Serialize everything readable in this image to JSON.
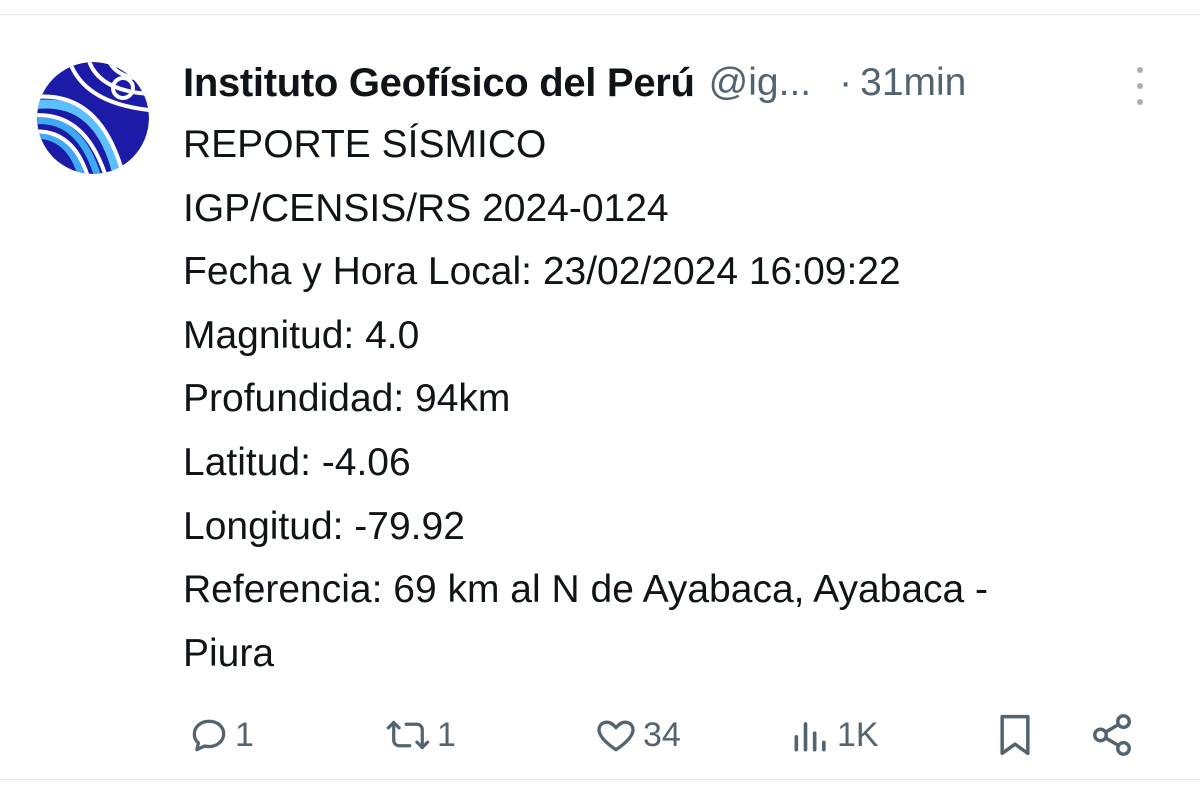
{
  "tweet": {
    "author_name": "Instituto Geofísico del Perú",
    "handle": "@ig...",
    "separator": "·",
    "time": "31min",
    "lines": [
      "REPORTE SÍSMICO",
      "IGP/CENSIS/RS 2024-0124",
      "Fecha y Hora Local: 23/02/2024 16:09:22",
      "Magnitud: 4.0",
      "Profundidad: 94km",
      "Latitud: -4.06",
      "Longitud: -79.92",
      "Referencia: 69 km al N de Ayabaca, Ayabaca -",
      "Piura"
    ]
  },
  "actions": {
    "reply": {
      "icon": "reply-icon",
      "count": "1"
    },
    "retweet": {
      "icon": "retweet-icon",
      "count": "1"
    },
    "like": {
      "icon": "heart-icon",
      "count": "34"
    },
    "views": {
      "icon": "views-icon",
      "count": "1K"
    },
    "bookmark": {
      "icon": "bookmark-icon"
    },
    "share": {
      "icon": "share-icon"
    }
  },
  "colors": {
    "text": "#0f1419",
    "secondary": "#536471",
    "logo_dark_blue": "#1b1ba8",
    "logo_light_blue": "#3fa9f5"
  }
}
